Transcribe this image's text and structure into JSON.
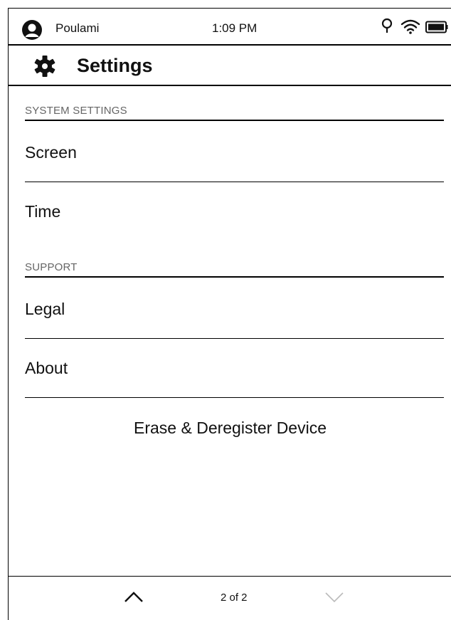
{
  "status_bar": {
    "user_name": "Poulami",
    "time": "1:09 PM",
    "icons": [
      "avatar-icon",
      "light-bulb-icon",
      "wifi-icon",
      "battery-icon"
    ]
  },
  "header": {
    "title": "Settings",
    "icon": "gear-icon"
  },
  "sections": {
    "system": {
      "label": "SYSTEM SETTINGS",
      "items": [
        "Screen",
        "Time"
      ]
    },
    "support": {
      "label": "SUPPORT",
      "items": [
        "Legal",
        "About"
      ]
    }
  },
  "erase_button": "Erase & Deregister Device",
  "footer": {
    "page_indicator": "2 of 2",
    "prev_icon": "chevron-up-icon",
    "next_icon": "chevron-down-icon",
    "next_disabled": true
  }
}
